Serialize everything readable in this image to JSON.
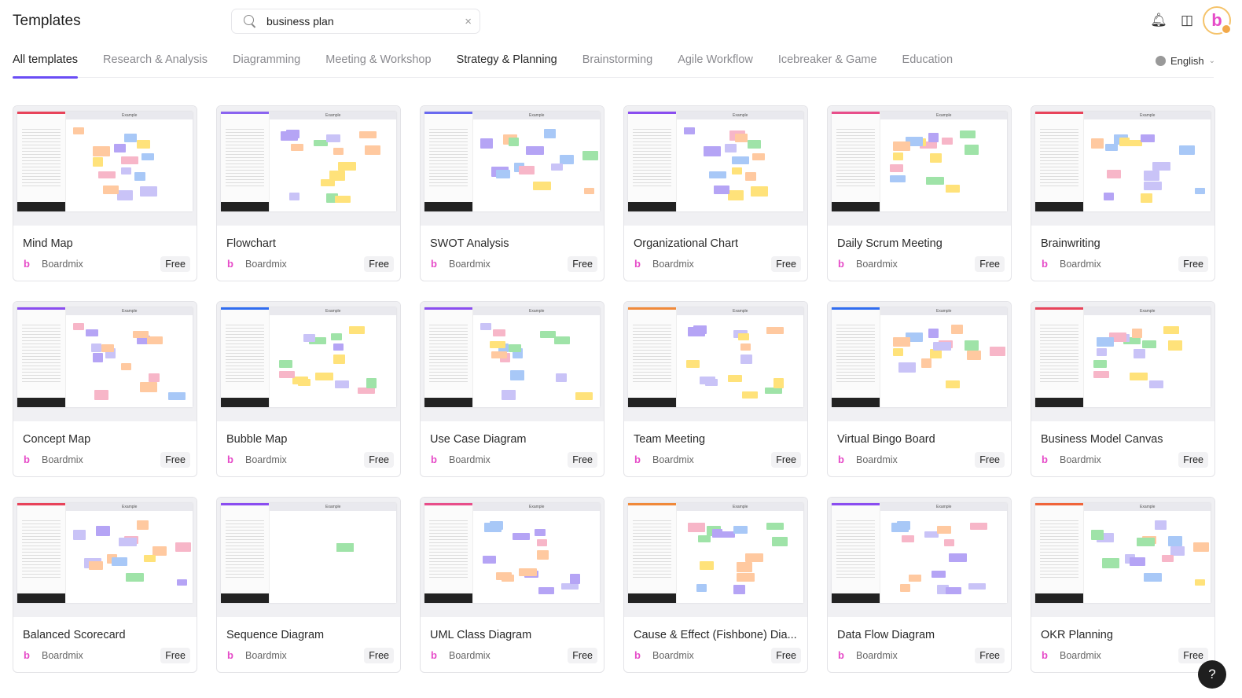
{
  "header": {
    "title": "Templates",
    "search_value": "business plan",
    "clear_icon": "×",
    "bell_icon": "bell-icon",
    "inbox_icon": "inbox-icon",
    "avatar_letter": "b"
  },
  "tabs": [
    {
      "label": "All templates",
      "state": "active"
    },
    {
      "label": "Research & Analysis"
    },
    {
      "label": "Diagramming"
    },
    {
      "label": "Meeting & Workshop"
    },
    {
      "label": "Strategy & Planning",
      "state": "dark"
    },
    {
      "label": "Brainstorming"
    },
    {
      "label": "Agile Workflow"
    },
    {
      "label": "Icebreaker & Game"
    },
    {
      "label": "Education"
    }
  ],
  "language": {
    "label": "English"
  },
  "accent": "#6a4df5",
  "thumb_example_label": "Example",
  "cards": [
    {
      "name": "Mind Map",
      "author": "Boardmix",
      "price": "Free",
      "color": "#e8435a"
    },
    {
      "name": "Flowchart",
      "author": "Boardmix",
      "price": "Free",
      "color": "#8a63f0"
    },
    {
      "name": "SWOT Analysis",
      "author": "Boardmix",
      "price": "Free",
      "color": "#6a6af0"
    },
    {
      "name": "Organizational Chart",
      "author": "Boardmix",
      "price": "Free",
      "color": "#8a4df0"
    },
    {
      "name": "Daily Scrum Meeting",
      "author": "Boardmix",
      "price": "Free",
      "color": "#e84e8a"
    },
    {
      "name": "Brainwriting",
      "author": "Boardmix",
      "price": "Free",
      "color": "#e8435a"
    },
    {
      "name": "Concept Map",
      "author": "Boardmix",
      "price": "Free",
      "color": "#8a4df0"
    },
    {
      "name": "Bubble Map",
      "author": "Boardmix",
      "price": "Free",
      "color": "#2f6cf0"
    },
    {
      "name": "Use Case Diagram",
      "author": "Boardmix",
      "price": "Free",
      "color": "#8a4df0"
    },
    {
      "name": "Team Meeting",
      "author": "Boardmix",
      "price": "Free",
      "color": "#f0893a"
    },
    {
      "name": "Virtual Bingo Board",
      "author": "Boardmix",
      "price": "Free",
      "color": "#2f6cf0"
    },
    {
      "name": "Business Model Canvas",
      "author": "Boardmix",
      "price": "Free",
      "color": "#e8435a"
    },
    {
      "name": "Balanced Scorecard",
      "author": "Boardmix",
      "price": "Free",
      "color": "#e8435a"
    },
    {
      "name": "Sequence Diagram",
      "author": "Boardmix",
      "price": "Free",
      "color": "#8a4df0"
    },
    {
      "name": "UML Class Diagram",
      "author": "Boardmix",
      "price": "Free",
      "color": "#e84e8a"
    },
    {
      "name": "Cause & Effect (Fishbone) Dia...",
      "author": "Boardmix",
      "price": "Free",
      "color": "#f0893a"
    },
    {
      "name": "Data Flow Diagram",
      "author": "Boardmix",
      "price": "Free",
      "color": "#8a4df0"
    },
    {
      "name": "OKR Planning",
      "author": "Boardmix",
      "price": "Free",
      "color": "#f0643a"
    }
  ],
  "help": {
    "label": "?"
  }
}
